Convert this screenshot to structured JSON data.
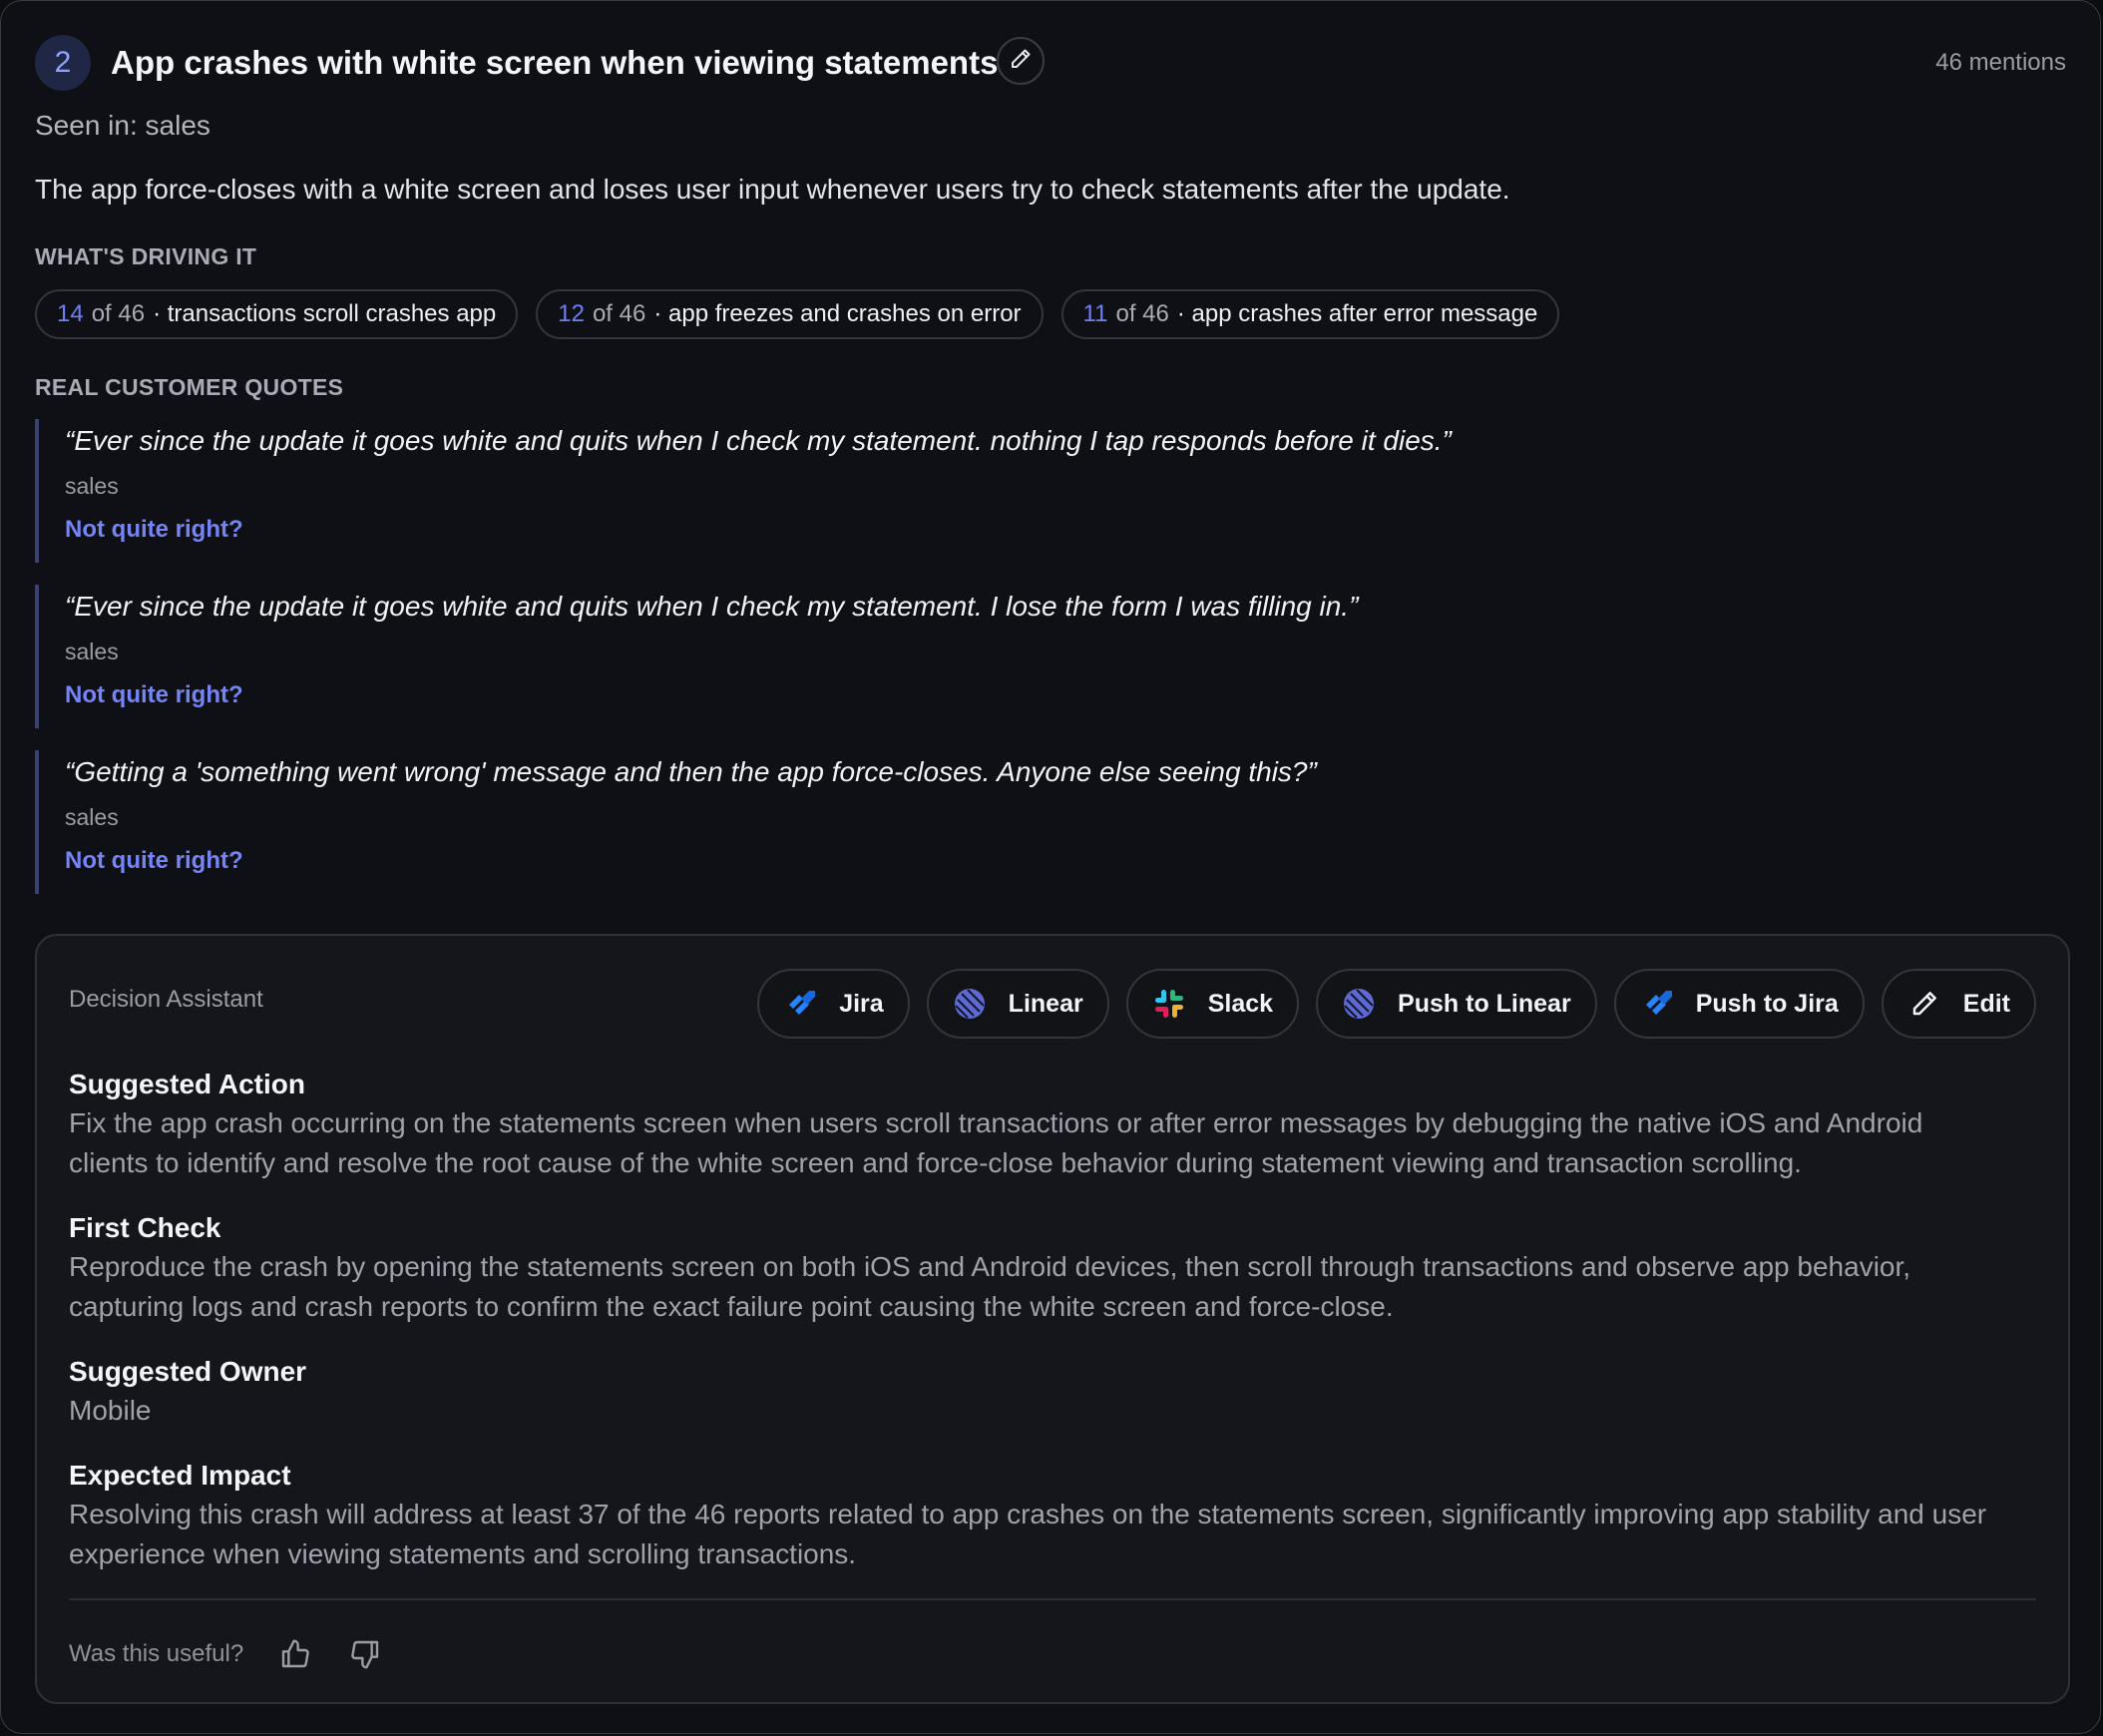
{
  "issue": {
    "rank": "2",
    "title": "App crashes with white screen when viewing statements",
    "mentions": "46 mentions",
    "seen_in": "Seen in: sales",
    "summary": "The app force-closes with a white screen and loses user input whenever users try to check statements after the update."
  },
  "drivers": {
    "label": "WHAT'S DRIVING IT",
    "items": [
      {
        "count": "14",
        "of": "of 46",
        "text": "· transactions scroll crashes app"
      },
      {
        "count": "12",
        "of": "of 46",
        "text": "· app freezes and crashes on error"
      },
      {
        "count": "11",
        "of": "of 46",
        "text": "· app crashes after error message"
      }
    ]
  },
  "quotes": {
    "label": "REAL CUSTOMER QUOTES",
    "items": [
      {
        "text": "“Ever since the update it goes white and quits when I check my statement. nothing I tap responds before it dies.”",
        "source": "sales",
        "fix_label": "Not quite right?"
      },
      {
        "text": "“Ever since the update it goes white and quits when I check my statement. I lose the form I was filling in.”",
        "source": "sales",
        "fix_label": "Not quite right?"
      },
      {
        "text": "“Getting a 'something went wrong' message and then the app force-closes. Anyone else seeing this?”",
        "source": "sales",
        "fix_label": "Not quite right?"
      }
    ]
  },
  "assistant": {
    "label": "Decision Assistant",
    "buttons": [
      {
        "label": "Jira",
        "icon": "jira-icon"
      },
      {
        "label": "Linear",
        "icon": "linear-icon"
      },
      {
        "label": "Slack",
        "icon": "slack-icon"
      },
      {
        "label": "Push to Linear",
        "icon": "linear-icon"
      },
      {
        "label": "Push to Jira",
        "icon": "jira-icon"
      },
      {
        "label": "Edit",
        "icon": "pencil-icon"
      }
    ],
    "suggested_action": {
      "title": "Suggested Action",
      "body": "Fix the app crash occurring on the statements screen when users scroll transactions or after error messages by debugging the native iOS and Android clients to identify and resolve the root cause of the white screen and force-close behavior during statement viewing and transaction scrolling."
    },
    "first_check": {
      "title": "First Check",
      "body": "Reproduce the crash by opening the statements screen on both iOS and Android devices, then scroll through transactions and observe app behavior, capturing logs and crash reports to confirm the exact failure point causing the white screen and force-close."
    },
    "suggested_owner": {
      "title": "Suggested Owner",
      "body": "Mobile"
    },
    "expected_impact": {
      "title": "Expected Impact",
      "body": "Resolving this crash will address at least 37 of the 46 reports related to app crashes on the statements screen, significantly improving app stability and user experience when viewing statements and scrolling transactions."
    },
    "feedback": {
      "label": "Was this useful?"
    }
  },
  "colors": {
    "accent": "#7584f7",
    "background": "#0f1015",
    "jira_blue": "#2684ff",
    "linear_indigo": "#5e6ad2"
  }
}
